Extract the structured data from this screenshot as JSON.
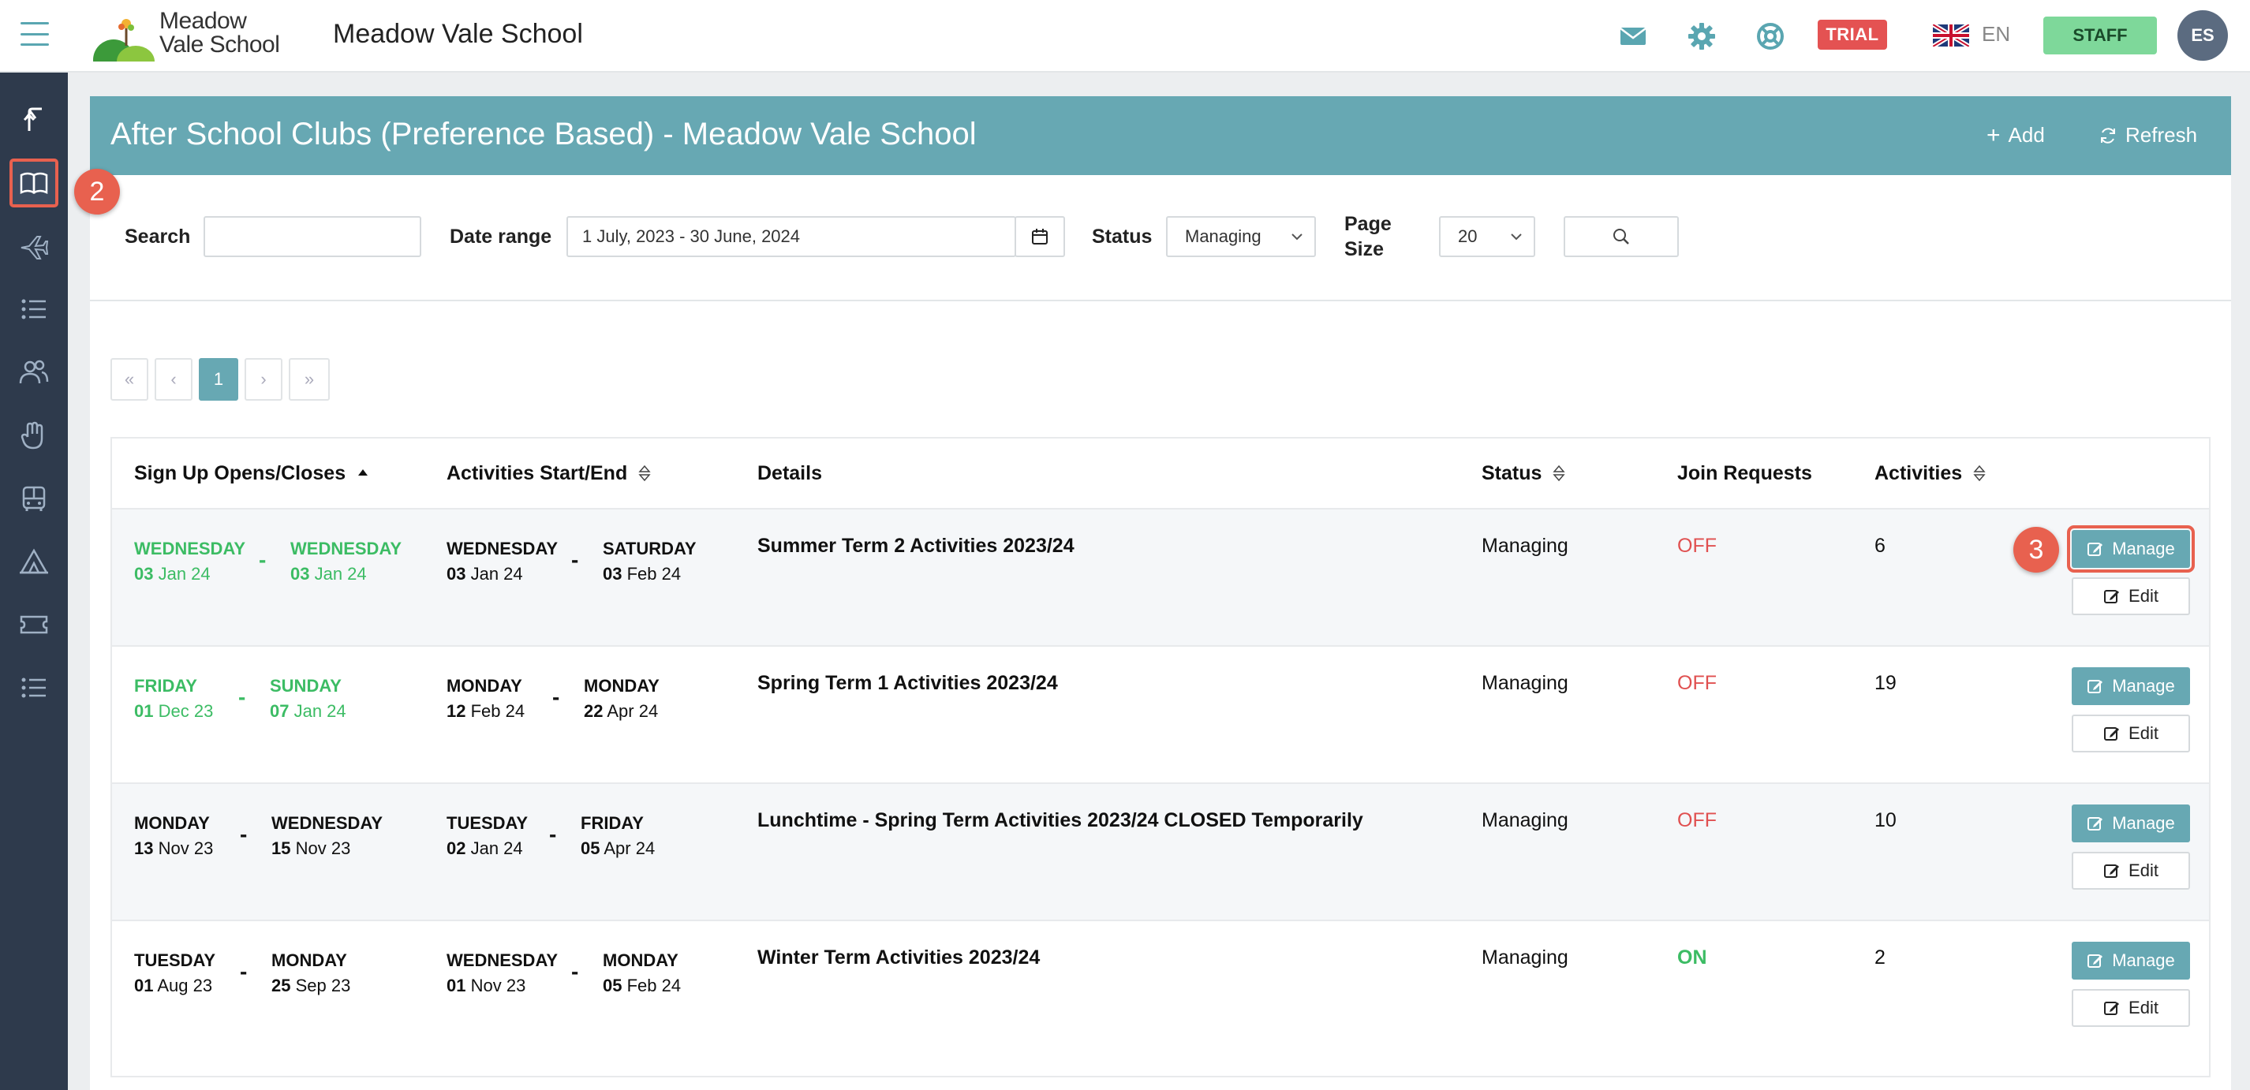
{
  "header": {
    "logo_line1": "Meadow",
    "logo_line2": "Vale School",
    "school_name": "Meadow Vale School",
    "trial_badge": "TRIAL",
    "language": "EN",
    "staff_button": "STAFF",
    "avatar_initials": "ES",
    "icons": [
      "mail-icon",
      "gear-icon",
      "help-lifebuoy-icon",
      "uk-flag-icon"
    ]
  },
  "sidebar": {
    "icons": [
      "upload-arrow-icon",
      "book-icon",
      "plane-icon",
      "list-icon",
      "users-icon",
      "hand-icon",
      "bus-icon",
      "tent-icon",
      "ticket-icon",
      "list-icon"
    ],
    "active_index": 1
  },
  "annotations": {
    "step2": "2",
    "step3": "3"
  },
  "panel": {
    "title": "After School Clubs (Preference Based) - Meadow Vale School",
    "add_label": "Add",
    "refresh_label": "Refresh"
  },
  "filters": {
    "search_label": "Search",
    "search_value": "",
    "date_range_label": "Date range",
    "date_range_value": "1 July, 2023 - 30 June, 2024",
    "status_label": "Status",
    "status_value": "Managing",
    "page_size_label_1": "Page",
    "page_size_label_2": "Size",
    "page_size_value": "20"
  },
  "pagination": {
    "first": "«",
    "prev": "‹",
    "current": "1",
    "next": "›",
    "last": "»"
  },
  "table": {
    "columns": {
      "signup": "Sign Up Opens/Closes",
      "activities_dates": "Activities Start/End",
      "details": "Details",
      "status": "Status",
      "join_requests": "Join Requests",
      "activities": "Activities"
    },
    "manage_label": "Manage",
    "edit_label": "Edit",
    "rows": [
      {
        "signup_open": {
          "day": "WEDNESDAY",
          "num": "03",
          "rest": " Jan 24"
        },
        "signup_close": {
          "day": "WEDNESDAY",
          "num": "03",
          "rest": " Jan 24"
        },
        "act_start": {
          "day": "WEDNESDAY",
          "num": "03",
          "rest": " Jan 24"
        },
        "act_end": {
          "day": "SATURDAY",
          "num": "03",
          "rest": " Feb 24"
        },
        "details": "Summer Term 2 Activities 2023/24",
        "status": "Managing",
        "join_requests": "OFF",
        "activities": "6"
      },
      {
        "signup_open": {
          "day": "FRIDAY",
          "num": "01",
          "rest": " Dec 23"
        },
        "signup_close": {
          "day": "SUNDAY",
          "num": "07",
          "rest": " Jan 24"
        },
        "act_start": {
          "day": "MONDAY",
          "num": "12",
          "rest": " Feb 24"
        },
        "act_end": {
          "day": "MONDAY",
          "num": "22",
          "rest": " Apr 24"
        },
        "details": "Spring Term 1 Activities 2023/24",
        "status": "Managing",
        "join_requests": "OFF",
        "activities": "19"
      },
      {
        "signup_open": {
          "day": "MONDAY",
          "num": "13",
          "rest": " Nov 23"
        },
        "signup_close": {
          "day": "WEDNESDAY",
          "num": "15",
          "rest": " Nov 23"
        },
        "act_start": {
          "day": "TUESDAY",
          "num": "02",
          "rest": " Jan 24"
        },
        "act_end": {
          "day": "FRIDAY",
          "num": "05",
          "rest": " Apr 24"
        },
        "details": "Lunchtime - Spring Term Activities 2023/24 CLOSED Temporarily",
        "status": "Managing",
        "join_requests": "OFF",
        "activities": "10"
      },
      {
        "signup_open": {
          "day": "TUESDAY",
          "num": "01",
          "rest": " Aug 23"
        },
        "signup_close": {
          "day": "MONDAY",
          "num": "25",
          "rest": " Sep 23"
        },
        "act_start": {
          "day": "WEDNESDAY",
          "num": "01",
          "rest": " Nov 23"
        },
        "act_end": {
          "day": "MONDAY",
          "num": "05",
          "rest": " Feb 24"
        },
        "details": "Winter Term Activities 2023/24",
        "status": "Managing",
        "join_requests": "ON",
        "activities": "2"
      }
    ]
  },
  "colors": {
    "accent": "#67a8b3",
    "sidebar_bg": "#2e3a4c",
    "trial": "#e45252",
    "staff": "#7ed89a",
    "annotation": "#e8614f",
    "green_text": "#3cbc64",
    "red_text": "#e05050"
  }
}
